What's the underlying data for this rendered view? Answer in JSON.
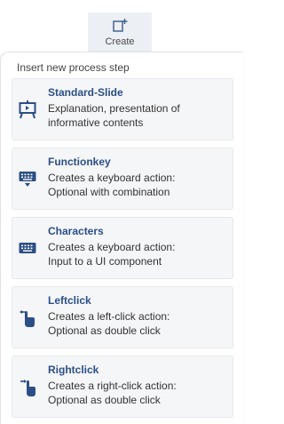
{
  "toolbar": {
    "create_label": "Create"
  },
  "panel": {
    "section_title": "Insert new process step",
    "steps": [
      {
        "title": "Standard-Slide",
        "desc_line1": "Explanation, presentation of",
        "desc_line2": "informative contents",
        "icon": "presentation-board-icon"
      },
      {
        "title": "Functionkey",
        "desc_line1": "Creates a keyboard action:",
        "desc_line2": "Optional with combination",
        "icon": "keyboard-down-icon"
      },
      {
        "title": "Characters",
        "desc_line1": "Creates a keyboard action:",
        "desc_line2": "Input to a UI component",
        "icon": "keyboard-icon"
      },
      {
        "title": "Leftclick",
        "desc_line1": "Creates a left-click action:",
        "desc_line2": "Optional as double click",
        "icon": "left-click-hand-icon"
      },
      {
        "title": "Rightclick",
        "desc_line1": "Creates a right-click action:",
        "desc_line2": "Optional as double click",
        "icon": "right-click-hand-icon"
      }
    ]
  },
  "colors": {
    "accent": "#2b4f86",
    "card_bg": "#f5f6f8",
    "button_bg": "#eceff3"
  }
}
